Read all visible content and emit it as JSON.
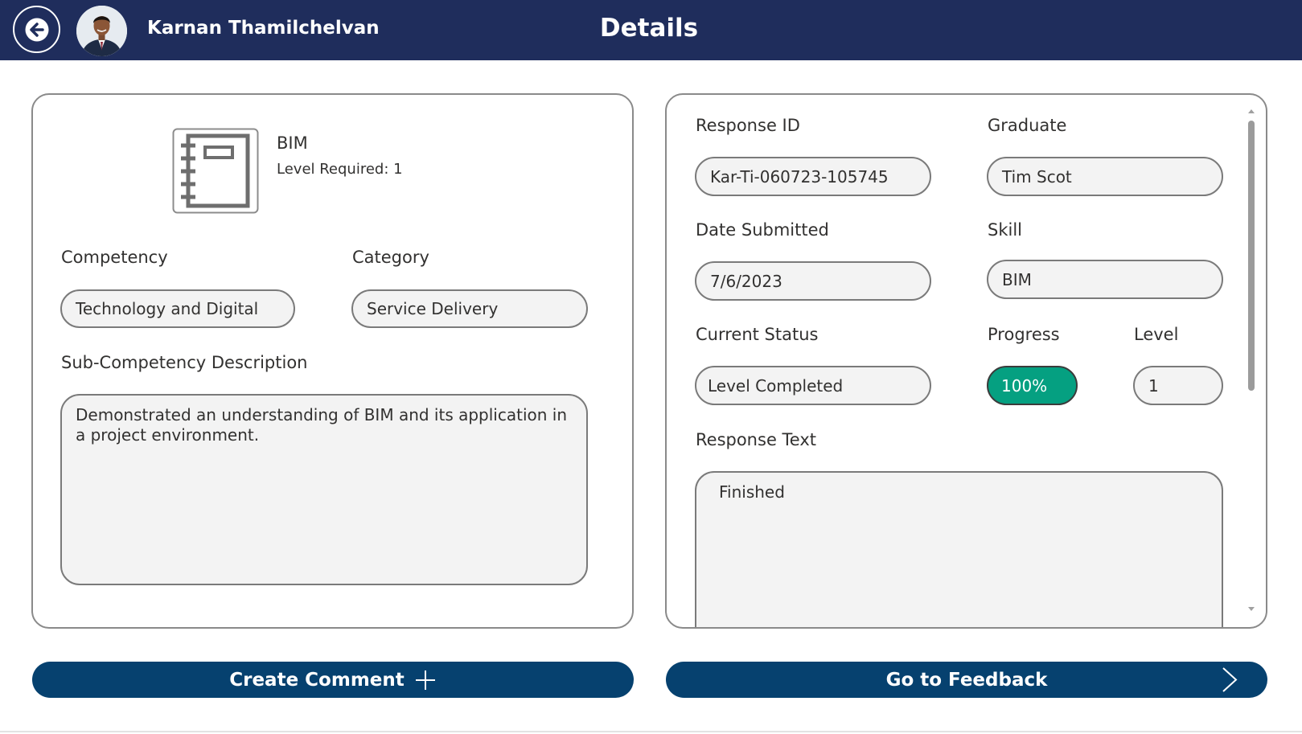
{
  "header": {
    "user_name": "Karnan Thamilchelvan",
    "title": "Details",
    "back_icon": "arrow-left-icon",
    "background_color": "#1f2d5c"
  },
  "left_card": {
    "skill_icon": "notebook-icon",
    "skill_name": "BIM",
    "level_required": "Level Required: 1",
    "competency": {
      "label": "Competency",
      "value": "Technology and Digital"
    },
    "category": {
      "label": "Category",
      "value": "Service Delivery"
    },
    "sub_competency": {
      "label": "Sub-Competency Description",
      "value": "Demonstrated an understanding of BIM and its application in a project environment."
    }
  },
  "right_card": {
    "response_id": {
      "label": "Response ID",
      "value": "Kar-Ti-060723-105745"
    },
    "graduate": {
      "label": "Graduate",
      "value": "Tim Scot"
    },
    "date_submitted": {
      "label": "Date Submitted",
      "value": "7/6/2023"
    },
    "skill": {
      "label": "Skill",
      "value": "BIM"
    },
    "current_status": {
      "label": "Current Status",
      "value": "Level Completed"
    },
    "progress": {
      "label": "Progress",
      "value": "100%",
      "fraction": 1.0,
      "color": "#05a081"
    },
    "level": {
      "label": "Level",
      "value": "1"
    },
    "response_text": {
      "label": "Response Text",
      "value": "Finished"
    }
  },
  "buttons": {
    "create_comment": "Create Comment",
    "create_comment_icon": "plus-icon",
    "go_to_feedback": "Go to Feedback",
    "go_to_feedback_icon": "chevron-right-icon",
    "color": "#06416f"
  }
}
